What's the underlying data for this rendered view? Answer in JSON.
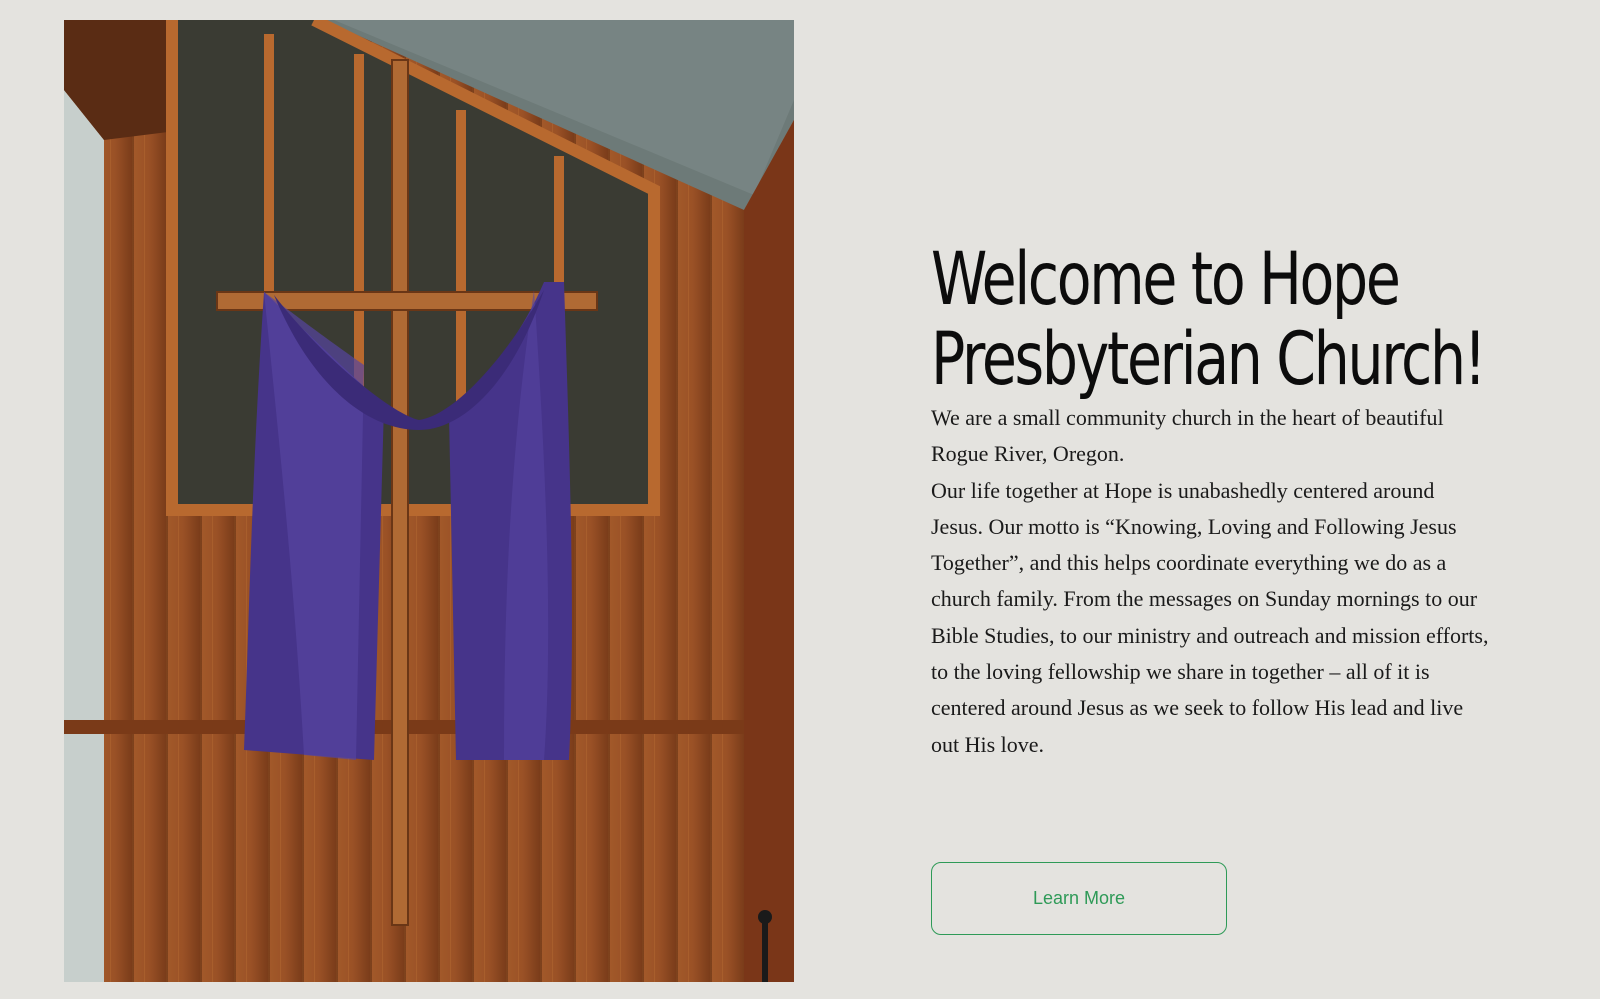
{
  "hero": {
    "headline_line1": "Welcome to Hope",
    "headline_line2": "Presbyterian Church!",
    "intro": "We are a small community church in the heart of beautiful Rogue River, Oregon.",
    "body": "Our life together at Hope is unabashedly centered around Jesus. Our motto is “Knowing, Loving and Following Jesus Together”, and this helps coordinate everything we do as a church family. From the messages on Sunday mornings to our Bible Studies, to our ministry and outreach and mission efforts, to the loving fellowship we share in together – all of it is centered around Jesus as we seek to follow His lead and live out His love.",
    "cta_label": "Learn More"
  },
  "colors": {
    "page_background": "#e4e3df",
    "heading_text": "#0c0c0c",
    "accent_green": "#2e9a57",
    "drape_purple": "#4a3682",
    "wood_paneling": "#9b5428"
  },
  "image": {
    "subject": "wooden cross draped with purple cloth on cedar wall"
  }
}
